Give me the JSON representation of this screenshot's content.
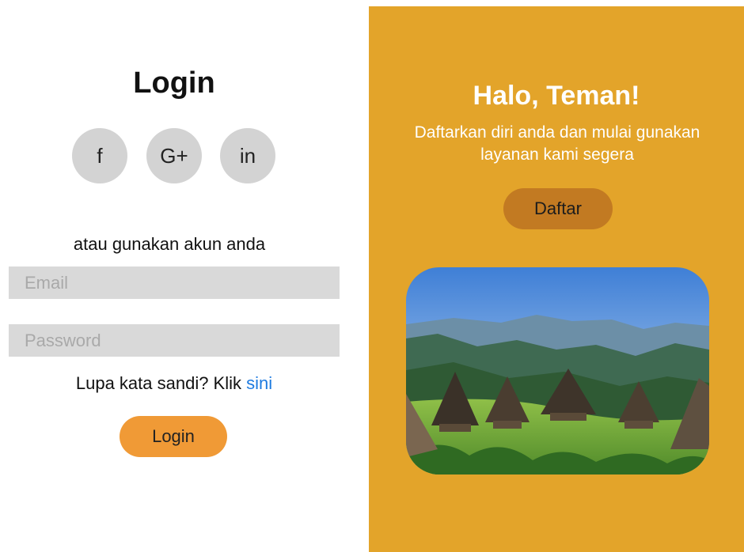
{
  "colors": {
    "accent_orange": "#f09a36",
    "panel_mustard": "#e3a42a",
    "signup_brown": "#c27a22",
    "social_gray": "#d3d3d3",
    "input_gray": "#d9d9d9",
    "link_blue": "#1e7be0"
  },
  "login": {
    "title": "Login",
    "social": [
      {
        "label": "f",
        "icon": "facebook-icon"
      },
      {
        "label": "G+",
        "icon": "google-plus-icon"
      },
      {
        "label": "in",
        "icon": "linkedin-icon"
      }
    ],
    "alt_text": "atau gunakan akun anda",
    "email_placeholder": "Email",
    "password_placeholder": "Password",
    "forgot_text": "Lupa kata sandi? Klik",
    "forgot_link": "sini",
    "button_label": "Login"
  },
  "signup": {
    "title": "Halo, Teman!",
    "tagline_line1": "Daftarkan diri anda dan mulai gunakan",
    "tagline_line2": "layanan kami segera",
    "button_label": "Daftar",
    "image": "village-landscape-photo"
  }
}
